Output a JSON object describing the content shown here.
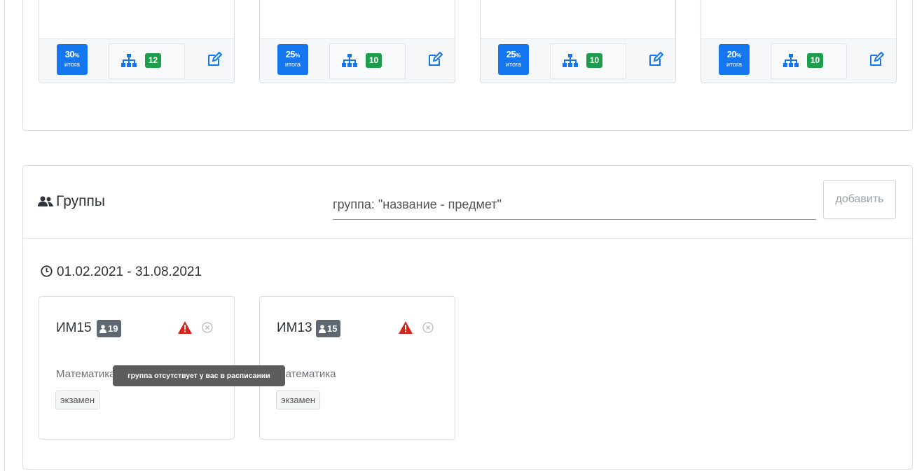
{
  "assessment_cards": [
    {
      "percent": "30",
      "percent_unit": "%",
      "percent_label": "итога",
      "count": "12"
    },
    {
      "percent": "25",
      "percent_unit": "%",
      "percent_label": "итога",
      "count": "10"
    },
    {
      "percent": "25",
      "percent_unit": "%",
      "percent_label": "итога",
      "count": "10"
    },
    {
      "percent": "20",
      "percent_unit": "%",
      "percent_label": "итога",
      "count": "10"
    }
  ],
  "groups": {
    "title": "Группы",
    "input_placeholder": "группа: \"название - предмет\"",
    "add_button": "добавить",
    "period": "01.02.2021 - 31.08.2021",
    "cards": [
      {
        "name": "ИМ15",
        "students": "19",
        "subject": "Математика",
        "tag": "экзамен"
      },
      {
        "name": "ИМ13",
        "students": "15",
        "subject": "Математика",
        "tag": "экзамен"
      }
    ],
    "tooltip": "группа отсутствует у вас в расписании"
  },
  "colors": {
    "percent_badge": "#1477f0",
    "count_badge": "#1e9e4c",
    "warning": "#d9241b",
    "student_badge": "#5f6770",
    "tooltip_bg": "#5d5d5d"
  },
  "icons": {
    "hierarchy": "sitemap-icon",
    "edit": "edit-icon",
    "users": "users-icon",
    "clock": "clock-icon",
    "warning": "warning-triangle-icon",
    "remove": "remove-circle-icon",
    "student": "user-icon"
  }
}
